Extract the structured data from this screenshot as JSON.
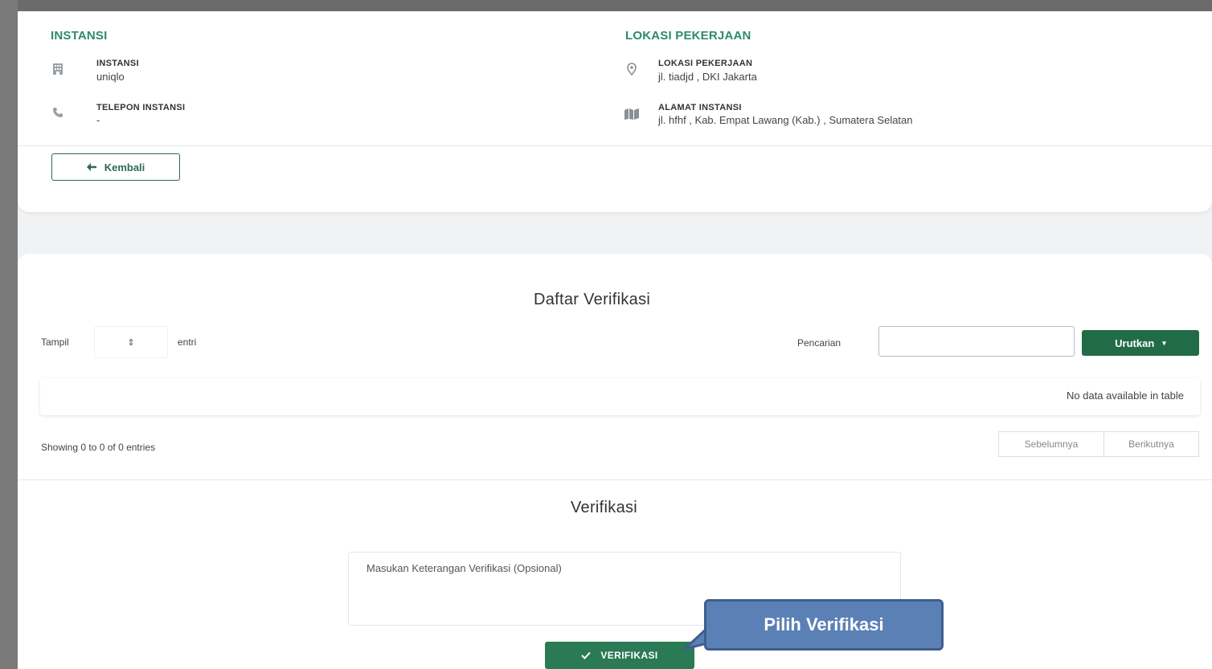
{
  "instansi_section": {
    "title": "INSTANSI",
    "items": [
      {
        "label": "INSTANSI",
        "value": "uniqlo",
        "icon": "building-icon"
      },
      {
        "label": "TELEPON INSTANSI",
        "value": "-",
        "icon": "phone-icon"
      }
    ]
  },
  "lokasi_section": {
    "title": "LOKASI PEKERJAAN",
    "items": [
      {
        "label": "LOKASI PEKERJAAN",
        "value": "jl. tiadjd , DKI Jakarta",
        "icon": "map-pin-icon"
      },
      {
        "label": "ALAMAT INSTANSI",
        "value": "jl. hfhf , Kab. Empat Lawang (Kab.) , Sumatera Selatan",
        "icon": "map-icon"
      }
    ]
  },
  "back_button": {
    "label": "Kembali",
    "icon": "arrow-left-icon"
  },
  "list": {
    "title": "Daftar Verifikasi",
    "show_label": "Tampil",
    "entries_label": "entri",
    "search_label": "Pencarian",
    "search_value": "",
    "sort_label": "Urutkan",
    "empty_text": "No data available in table",
    "info_text": "Showing 0 to 0 of 0 entries",
    "prev_label": "Sebelumnya",
    "next_label": "Berikutnya"
  },
  "verification": {
    "title": "Verifikasi",
    "placeholder": "Masukan Keterangan Verifikasi (Opsional)",
    "button_label": "VERIFIKASI",
    "button_icon": "check-icon"
  },
  "callout": {
    "text": "Pilih Verifikasi"
  },
  "colors": {
    "accent": "#2e8b6a",
    "button": "#226b47",
    "callout": "#5b80b6"
  }
}
